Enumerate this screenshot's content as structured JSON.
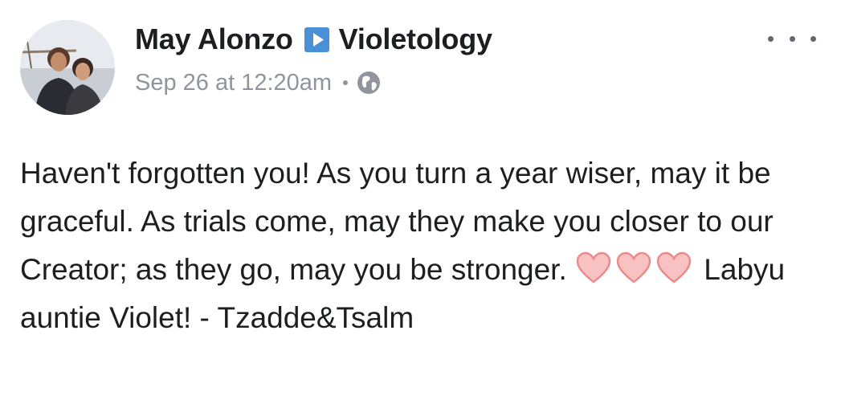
{
  "post": {
    "author": "May Alonzo",
    "target_page": "Violetology",
    "timestamp": "Sep 26 at 12:20am",
    "privacy_icon": "globe-icon",
    "more_icon": "more-options-icon",
    "message_part1": "Haven't forgotten you! As you turn a year wiser, may it be graceful. As trials come, may they make you closer to our Creator; as they go, may you be stronger.",
    "hearts": [
      "heart-icon",
      "heart-icon",
      "heart-icon"
    ],
    "message_part2": " Labyu auntie Violet! - Tzadde&Tsalm"
  },
  "colors": {
    "text": "#1c1e21",
    "meta": "#90949c",
    "arrow_blue": "#4a90d9",
    "heart_fill": "#f8c2c2",
    "heart_stroke": "#e98b8b"
  }
}
